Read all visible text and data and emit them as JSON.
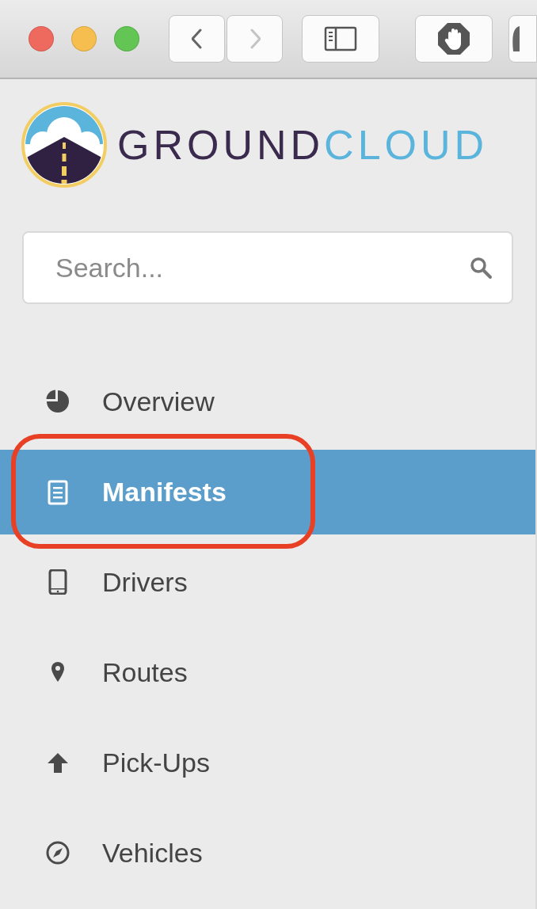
{
  "toolbar": {
    "window_controls": [
      {
        "color": "#ee6a5f"
      },
      {
        "color": "#f5be4f"
      },
      {
        "color": "#62c554"
      }
    ],
    "nav_buttons": [
      {
        "kind": "back",
        "disabled": false
      },
      {
        "kind": "forward",
        "disabled": true
      }
    ],
    "tool_buttons": [
      {
        "kind": "sidebar"
      },
      {
        "kind": "block"
      },
      {
        "kind": "partial"
      }
    ]
  },
  "logo": {
    "parts": [
      {
        "text": "GROUND",
        "color": "#3a2a4d"
      },
      {
        "text": "CLOUD",
        "color": "#5ab4dc"
      }
    ]
  },
  "search": {
    "placeholder": "Search..."
  },
  "nav": [
    {
      "label": "Overview",
      "kind": "pie",
      "selected": false,
      "highlighted": false
    },
    {
      "label": "Manifests",
      "kind": "document",
      "selected": true,
      "highlighted": true
    },
    {
      "label": "Drivers",
      "kind": "phone",
      "selected": false,
      "highlighted": false
    },
    {
      "label": "Routes",
      "kind": "pin",
      "selected": false,
      "highlighted": false
    },
    {
      "label": "Pick-Ups",
      "kind": "arrow-up",
      "selected": false,
      "highlighted": false
    },
    {
      "label": "Vehicles",
      "kind": "compass",
      "selected": false,
      "highlighted": false
    }
  ]
}
